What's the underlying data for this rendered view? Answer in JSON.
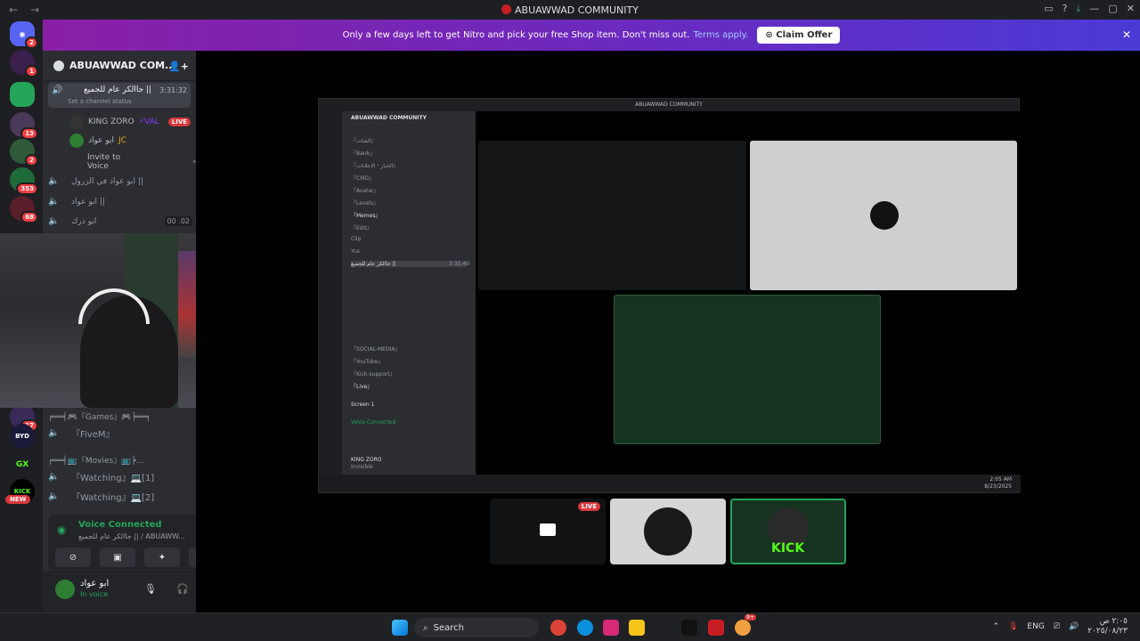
{
  "window": {
    "title": "ABUAWWAD COMMUNITY",
    "back_glyph": "←",
    "fwd_glyph": "→"
  },
  "banner": {
    "text": "Only a few days left to get Nitro and pick your free Shop item. Don't miss out.",
    "link": "Terms apply.",
    "button": "Claim Offer",
    "close": "✕"
  },
  "server": {
    "name": "ABUAWWAD COM...",
    "chevron": "⌄"
  },
  "guild_badges": {
    "home": "2",
    "g1": "1",
    "g2": "13",
    "g3": "2",
    "g4": "353",
    "g5": "68",
    "g6": "17",
    "new": "NEW"
  },
  "guild_labels": {
    "byd": "BYD",
    "gx": "GX",
    "kick": "KICK"
  },
  "channels": {
    "active_name": "جاالكر عام للجميع ||",
    "active_timer": "3:31:32",
    "status": "Set a channel status",
    "user1": "KING ZORO",
    "user1_tag": "⚡VAL",
    "live": "LIVE",
    "user2": "ابو عواد",
    "user2_tag": "JC",
    "invite": "Invite to Voice",
    "ch2": "ابو عواد في الزرول ||",
    "ch3": "ابو عواد ||",
    "ch4": "ابو ذرك",
    "ch4_count": "00 .02",
    "cat_games": "╒══╡🎮『Games』🎮╞══╕",
    "fivem": "『FiveM』",
    "cat_movies": "╒══╡📺『Movies』📺╞...",
    "watching1": "『Watching』💻[1]",
    "watching2": "『Watching』💻[2]"
  },
  "voice": {
    "connected": "Voice Connected",
    "channel": "جاالكر عام للجميع || / ABUAWW..."
  },
  "user": {
    "name": "ابو عواد",
    "status": "In voice"
  },
  "inner": {
    "title": "ABUAWWAD COMMUNITY",
    "items": [
      "『الشات』",
      "『Bank』",
      "『الخبار・الإعلانات』",
      "『CMD』",
      "『Avatar』",
      "『Levels』",
      "『Memes』",
      "『Edit』",
      "Clip",
      "Yus"
    ],
    "voice": "جاالكر عام للجميع ||",
    "timer": "3:31:40",
    "screen": "Screen 1",
    "vc": "Voice Connected",
    "user": "KING ZORO",
    "user_status": "Invisible",
    "socials": [
      "『SOCIAL-MEDIA』",
      "『YouTube』",
      "『Kick-support』",
      "『Live』"
    ],
    "clock": "2:05 AM",
    "date": "8/23/2025"
  },
  "thumbs": {
    "live": "LIVE",
    "kick": "KICK"
  },
  "taskbar": {
    "search": "Search",
    "lang": "ENG",
    "time": "٢:٠٥ ص",
    "date": "٢٠٢٥/٠٨/٢٣",
    "notif": "9+"
  },
  "colors": {
    "banner_start": "#8a1fa6",
    "banner_end": "#4b3ad6",
    "green": "#23a55a",
    "live": "#da373c"
  }
}
